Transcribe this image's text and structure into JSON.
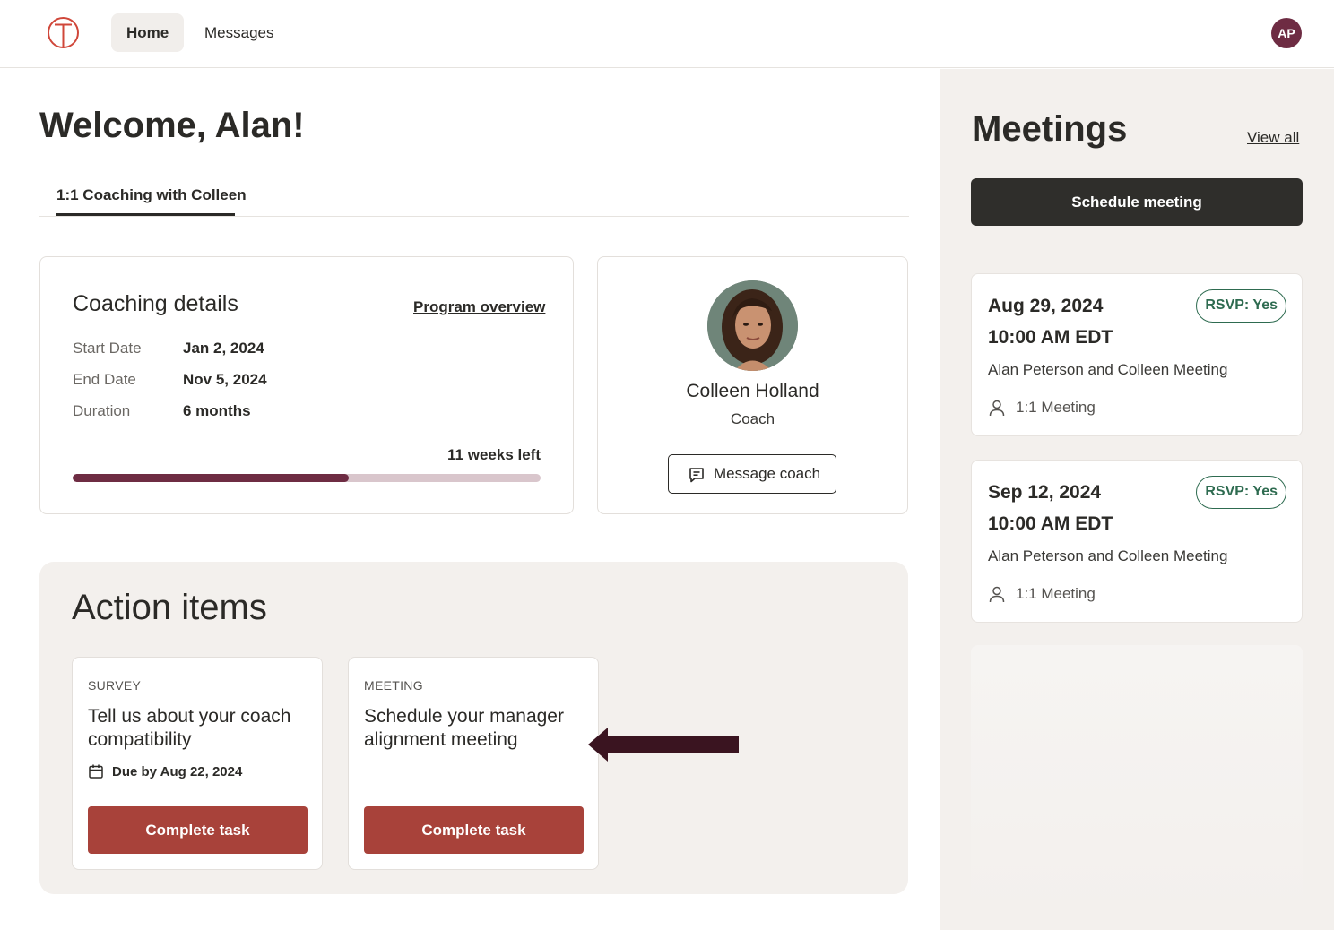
{
  "nav": {
    "home_label": "Home",
    "messages_label": "Messages",
    "avatar_initials": "AP"
  },
  "main": {
    "welcome": "Welcome, Alan!",
    "tab_label": "1:1 Coaching with Colleen",
    "details": {
      "title": "Coaching details",
      "overview_link": "Program overview",
      "rows": [
        {
          "label": "Start Date",
          "value": "Jan 2, 2024"
        },
        {
          "label": "End Date",
          "value": "Nov 5, 2024"
        },
        {
          "label": "Duration",
          "value": "6 months"
        }
      ],
      "weeks_left": "11 weeks left",
      "progress_fraction": 0.59
    },
    "coach": {
      "name": "Colleen Holland",
      "role": "Coach",
      "message_button": "Message coach"
    },
    "actions": {
      "title": "Action items",
      "items": [
        {
          "kind": "SURVEY",
          "title": "Tell us about your coach compatibility",
          "due": "Due by Aug 22, 2024",
          "button": "Complete task"
        },
        {
          "kind": "MEETING",
          "title": "Schedule your manager alignment meeting",
          "due": "",
          "button": "Complete task"
        }
      ]
    }
  },
  "meetings": {
    "title": "Meetings",
    "view_all": "View all",
    "schedule_button": "Schedule meeting",
    "items": [
      {
        "date": "Aug 29, 2024",
        "time": "10:00 AM EDT",
        "description": "Alan Peterson and Colleen Meeting",
        "rsvp": "RSVP: Yes",
        "type": "1:1 Meeting"
      },
      {
        "date": "Sep 12, 2024",
        "time": "10:00 AM EDT",
        "description": "Alan Peterson and Colleen Meeting",
        "rsvp": "RSVP: Yes",
        "type": "1:1 Meeting"
      }
    ]
  },
  "colors": {
    "brand": "#6e2c43",
    "action_button": "#a8423a",
    "rsvp_green": "#2e6b50",
    "dark_button": "#2f2e2b",
    "logo_red": "#d0473a"
  },
  "icons": [
    "logo-icon",
    "person-icon",
    "chat-icon",
    "calendar-icon",
    "arrow-icon"
  ]
}
